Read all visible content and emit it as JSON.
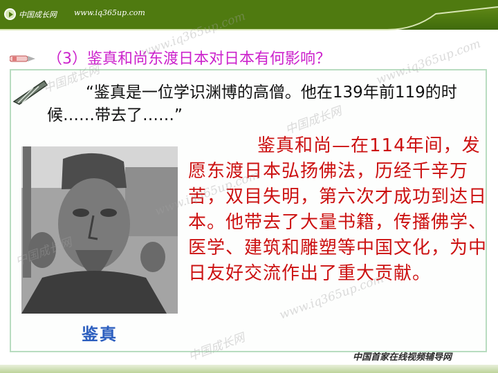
{
  "header": {
    "brand": "中国成长网",
    "site": "www.iq365up.com"
  },
  "heading": "（3）鉴真和尚东渡日本对日本有何影响？",
  "quote": "“鉴真是一位学识渊博的高僧。他在139年前119的时候……带去了……”",
  "body_text": "鉴真和尚—在114年间，发愿东渡日本弘扬佛法，历经千辛万苦，双目失明，第六次才成功到达日本。他带去了大量书籍，传播佛学、医学、建筑和雕塑等中国文化，为中日友好交流作出了重大贡献。",
  "caption": "鉴真",
  "footer": "中国首家在线视频辅导网",
  "watermarks": {
    "a": "www.iq365up.com",
    "b": "中国成长网"
  },
  "colors": {
    "banner": "#4f7a10",
    "heading": "#cc22cc",
    "body": "#cc1111",
    "caption": "#2d5fbf"
  }
}
